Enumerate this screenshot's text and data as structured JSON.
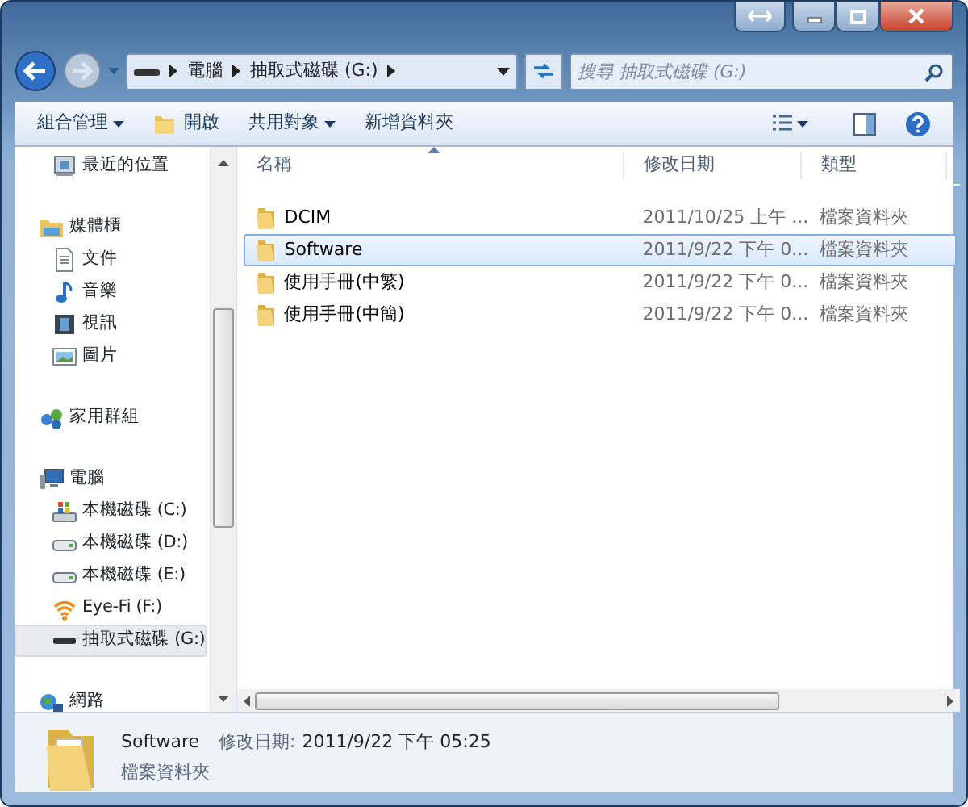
{
  "address": {
    "crumbs": [
      "電腦",
      "抽取式磁碟 (G:)"
    ]
  },
  "search": {
    "placeholder": "搜尋 抽取式磁碟 (G:)"
  },
  "toolbar": [
    {
      "label": "組合管理",
      "kind": "menu"
    },
    {
      "label": "開啟",
      "kind": "open"
    },
    {
      "label": "共用對象",
      "kind": "menu"
    },
    {
      "label": "新增資料夾",
      "kind": "plain"
    }
  ],
  "nav": [
    {
      "children": [
        {
          "label": "最近的位置",
          "kind": "recent",
          "selected": false
        }
      ]
    },
    {
      "label": "媒體櫃",
      "kind": "library",
      "selected": false,
      "children": [
        {
          "label": "文件",
          "kind": "doc",
          "selected": false
        },
        {
          "label": "音樂",
          "kind": "music",
          "selected": false
        },
        {
          "label": "視訊",
          "kind": "video",
          "selected": false
        },
        {
          "label": "圖片",
          "kind": "image",
          "selected": false
        }
      ]
    },
    {
      "label": "家用群組",
      "kind": "homegroup",
      "selected": false
    },
    {
      "label": "電腦",
      "kind": "computer",
      "selected": false,
      "children": [
        {
          "label": "本機磁碟 (C:)",
          "kind": "sysdrive",
          "selected": false
        },
        {
          "label": "本機磁碟 (D:)",
          "kind": "drive",
          "selected": false
        },
        {
          "label": "本機磁碟 (E:)",
          "kind": "drive",
          "selected": false
        },
        {
          "label": "Eye-Fi (F:)",
          "kind": "wifi",
          "selected": false
        },
        {
          "label": "抽取式磁碟 (G:)",
          "kind": "removable",
          "selected": true
        }
      ]
    },
    {
      "label": "網路",
      "kind": "network",
      "selected": false
    }
  ],
  "table": {
    "columns": [
      "名稱",
      "修改日期",
      "類型"
    ],
    "rows": [
      {
        "name": "DCIM",
        "date": "2011/10/25 上午 ...",
        "type": "檔案資料夾",
        "selected": false
      },
      {
        "name": "Software",
        "date": "2011/9/22 下午 0...",
        "type": "檔案資料夾",
        "selected": true
      },
      {
        "name": "使用手冊(中繁)",
        "date": "2011/9/22 下午 0...",
        "type": "檔案資料夾",
        "selected": false
      },
      {
        "name": "使用手冊(中簡)",
        "date": "2011/9/22 下午 0...",
        "type": "檔案資料夾",
        "selected": false
      }
    ]
  },
  "status_bar": {
    "name": "Software",
    "detail_label": "修改日期:",
    "detail_value": "2011/9/22 下午 05:25",
    "type": "檔案資料夾"
  }
}
